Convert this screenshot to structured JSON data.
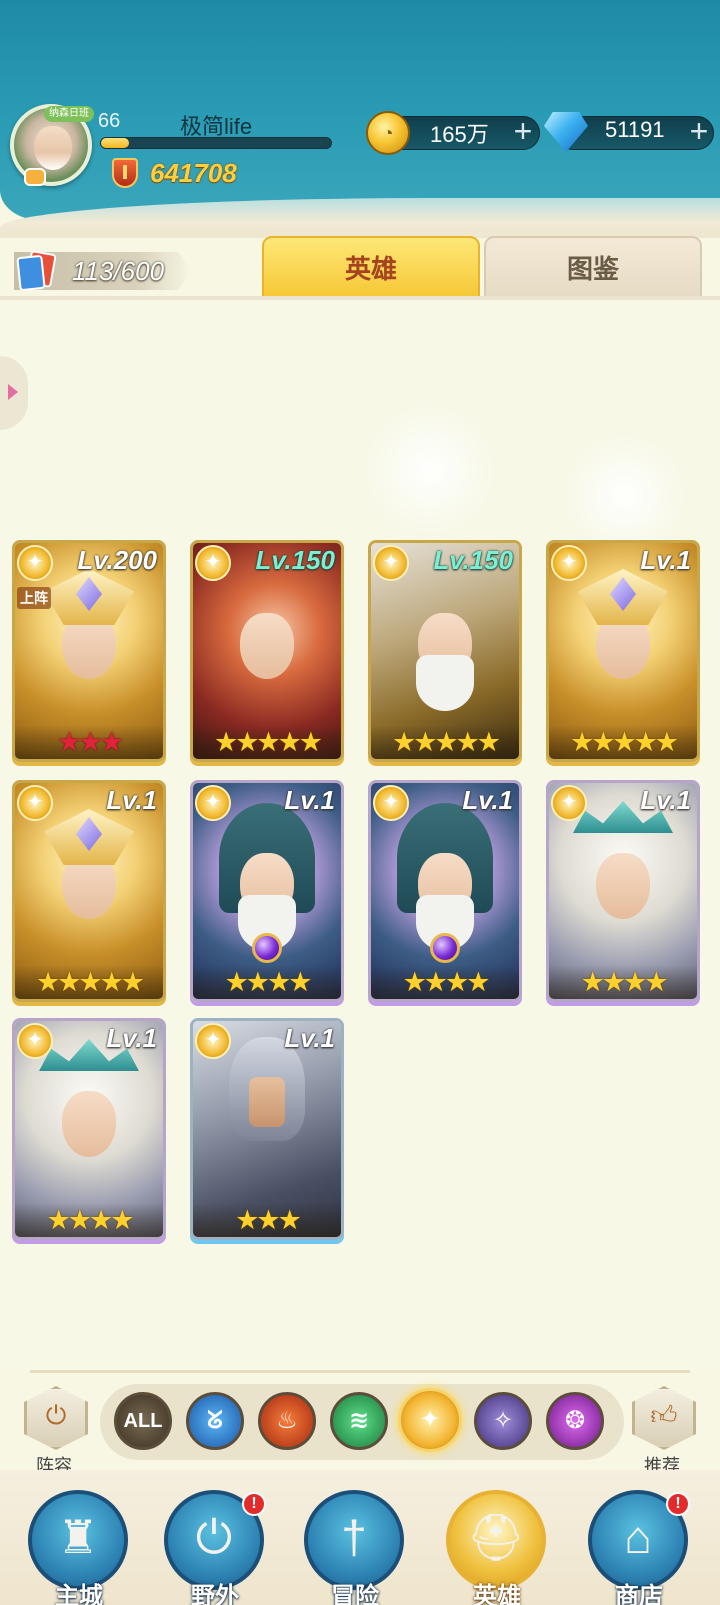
{
  "player": {
    "level": "66",
    "name": "极简life",
    "exp_fraction": 0.12,
    "power": "641708",
    "avatar_ribbon": "纳森日班"
  },
  "resources": {
    "gold": "165万",
    "gems": "51191"
  },
  "roster": {
    "count": "113/600"
  },
  "tabs": {
    "heroes": "英雄",
    "atlas": "图鉴"
  },
  "heroes": [
    {
      "level": "Lv.200",
      "deploy": "上阵",
      "stars": "★★★",
      "star_color": "red",
      "rarity": "gold",
      "art": "warrior-red"
    },
    {
      "level": "Lv.150",
      "stars": "★★★★★",
      "star_color": "gold",
      "rarity": "gold",
      "art": "mage-red"
    },
    {
      "level": "Lv.150",
      "stars": "★★★★★",
      "star_color": "gold",
      "rarity": "gold",
      "art": "knight-old"
    },
    {
      "level": "Lv.1",
      "stars": "★★★★★",
      "star_color": "gold",
      "rarity": "gold",
      "art": "warrior-red"
    },
    {
      "level": "Lv.1",
      "stars": "★★★★★",
      "star_color": "gold",
      "rarity": "gold",
      "art": "warrior-red"
    },
    {
      "level": "Lv.1",
      "stars": "★★★★",
      "star_color": "gold",
      "rarity": "purple",
      "art": "wizard"
    },
    {
      "level": "Lv.1",
      "stars": "★★★★",
      "star_color": "gold",
      "rarity": "purple",
      "art": "wizard"
    },
    {
      "level": "Lv.1",
      "stars": "★★★★",
      "star_color": "gold",
      "rarity": "purple",
      "art": "priestess"
    },
    {
      "level": "Lv.1",
      "stars": "★★★★",
      "star_color": "gold",
      "rarity": "purple",
      "art": "priestess"
    },
    {
      "level": "Lv.1",
      "stars": "★★★",
      "star_color": "gold",
      "rarity": "blue",
      "art": "armored"
    }
  ],
  "filters": {
    "lineup_label": "阵容",
    "recommend_label": "推荐",
    "all_label": "ALL",
    "selected": "light"
  },
  "nav": {
    "main_city": "主城",
    "wild": "野外",
    "adventure": "冒险",
    "heroes": "英雄",
    "shop": "商店",
    "alert": "!"
  },
  "colors": {
    "header": "#2b9cb5",
    "accent_gold": "#f6c836",
    "background": "#f7f8e6"
  }
}
